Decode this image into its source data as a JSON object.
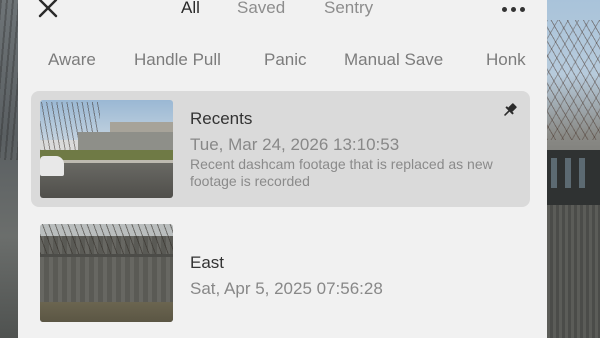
{
  "header": {
    "tabs": [
      {
        "label": "All",
        "active": true
      },
      {
        "label": "Saved",
        "active": false
      },
      {
        "label": "Sentry",
        "active": false
      }
    ]
  },
  "filters": [
    "Aware",
    "Handle Pull",
    "Panic",
    "Manual Save",
    "Honk"
  ],
  "clips": [
    {
      "title": "Recents",
      "date": "Tue, Mar 24, 2026 13:10:53",
      "description": "Recent dashcam footage that is replaced as new footage is recorded",
      "pinned": true,
      "selected": true
    },
    {
      "title": "East",
      "date": "Sat, Apr 5, 2025 07:56:28",
      "description": "",
      "pinned": false,
      "selected": false
    }
  ],
  "colors": {
    "panel_bg": "#f1f1f1",
    "selected_row_bg": "#dadada",
    "active_tab": "#2a2a2a",
    "inactive_tab": "#8d8d8d"
  },
  "icons": {
    "close": "close-icon",
    "more": "more-icon",
    "pin": "pin-icon"
  }
}
